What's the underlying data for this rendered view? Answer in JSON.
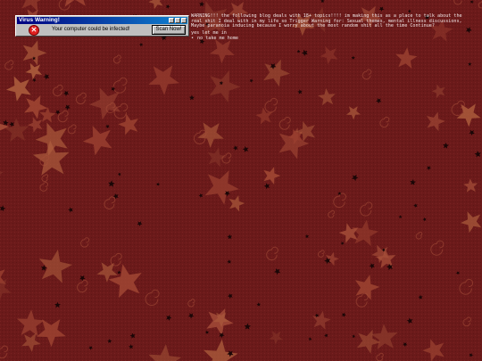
{
  "popup": {
    "title": "Virus Warning!",
    "message": "Your computer could be infected!",
    "scan_button_label": "Scan Now!",
    "error_icon_glyph": "✕",
    "controls": [
      "minimize-icon",
      "maximize-icon",
      "close-icon"
    ]
  },
  "warning": {
    "text": "WARNING!!! the following blog deals with 18+ topics!!!! im making this as a place to talk about the real shit I deal with in my life so Trigger Warning for: Sexual themes, mental illness discussions, Maybe paranoia inducing because I worry about the most random shit all the time Continue?",
    "links": [
      {
        "label": "yes let me in"
      },
      {
        "label": "no take me home"
      }
    ]
  },
  "colors": {
    "background": "#6b1a1a",
    "star_light": "#a8503a",
    "star_dark": "#1a0606",
    "titlebar": "#000080",
    "warning_text": "#f0e6e6"
  }
}
